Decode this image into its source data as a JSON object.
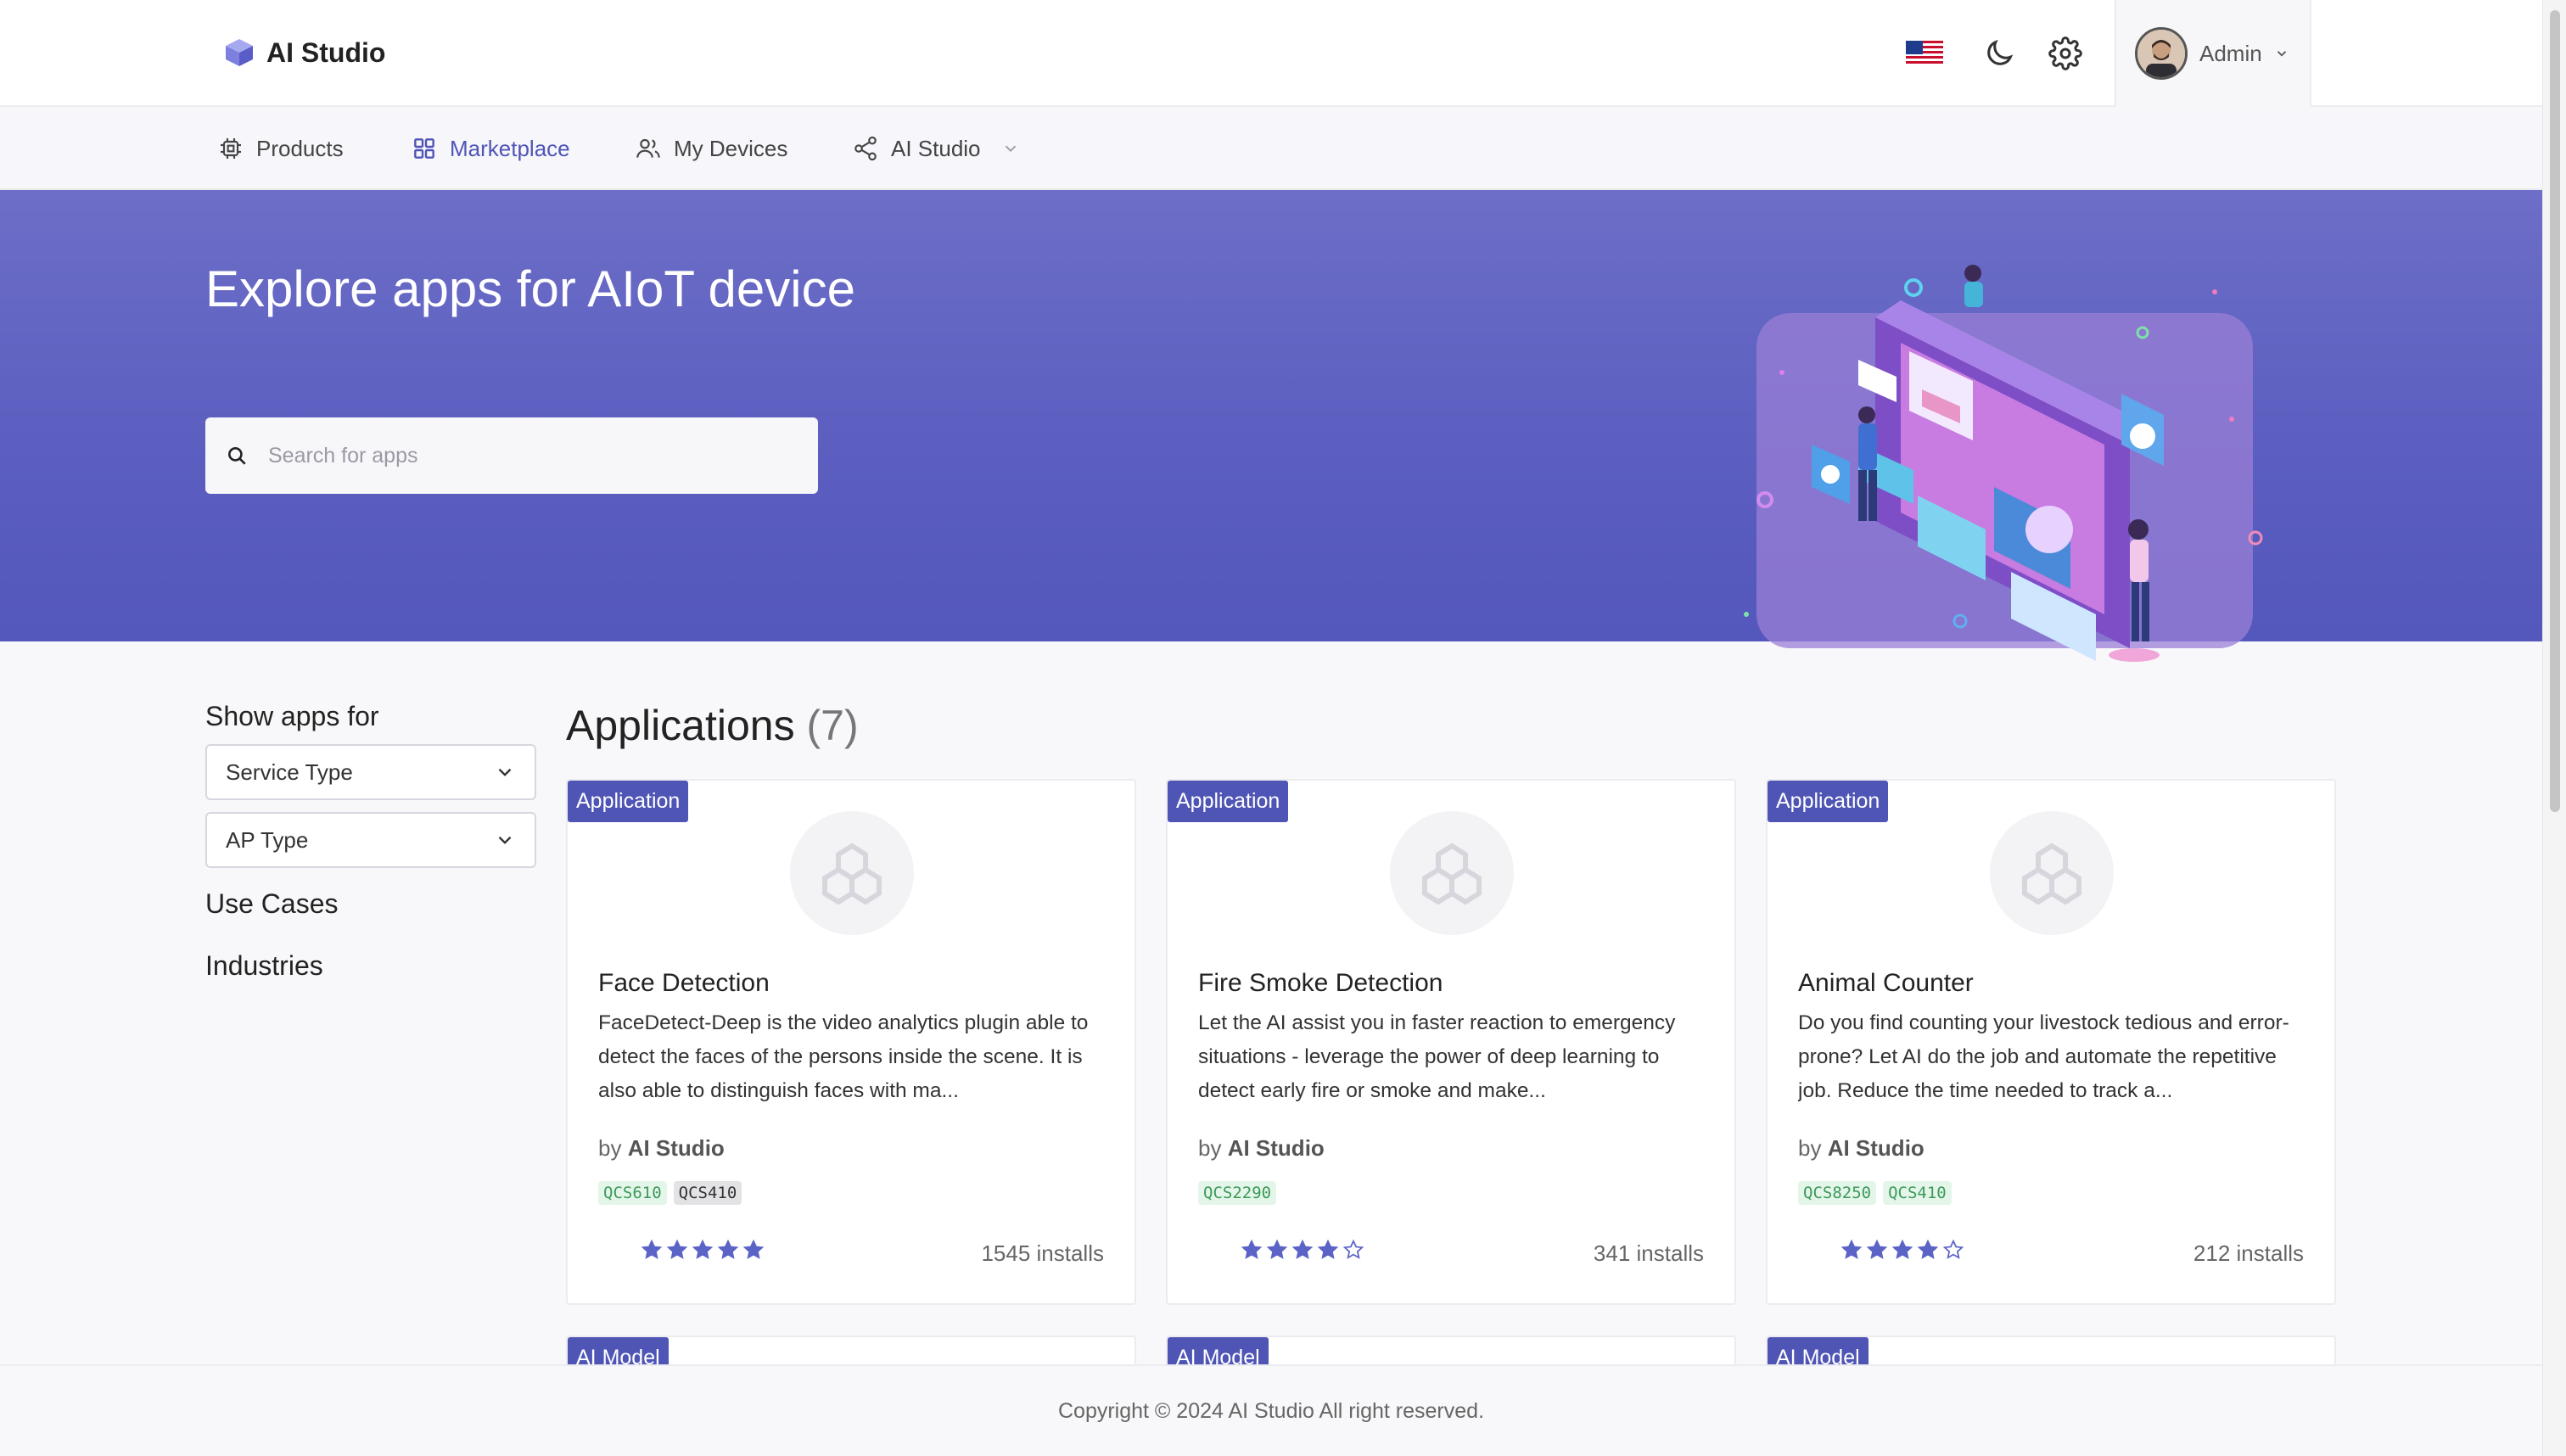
{
  "header": {
    "brand": "AI Studio",
    "user_name": "Admin",
    "icons": [
      "us-flag-icon",
      "moon-icon",
      "gear-icon",
      "avatar",
      "chevron-down-icon"
    ]
  },
  "nav": {
    "items": [
      {
        "label": "Products",
        "icon": "chip-icon"
      },
      {
        "label": "Marketplace",
        "icon": "grid-icon",
        "active": true
      },
      {
        "label": "My Devices",
        "icon": "users-icon"
      },
      {
        "label": "AI Studio",
        "icon": "share-icon"
      }
    ]
  },
  "hero": {
    "title": "Explore apps for AIoT device",
    "search_placeholder": "Search for apps"
  },
  "sidebar": {
    "title": "Show apps for",
    "service_type": "Service Type",
    "ap_type": "AP Type",
    "use_cases": "Use Cases",
    "industries": "Industries"
  },
  "applications": {
    "title": "Applications",
    "count": "(7)",
    "cards": [
      {
        "badge": "Application",
        "name": "Face Detection",
        "description": "FaceDetect-Deep is the video analytics plugin able to detect the faces of the persons inside the scene. It is also able to distinguish faces with ma...",
        "by_prefix": "by",
        "author": "AI Studio",
        "chips": [
          "QCS610",
          "QCS410"
        ],
        "rating": 5,
        "installs": "1545 installs"
      },
      {
        "badge": "Application",
        "name": "Fire Smoke Detection",
        "description": "Let the AI assist you in faster reaction to emergency situations - leverage the power of deep learning to detect early fire or smoke and make...",
        "by_prefix": "by",
        "author": "AI Studio",
        "chips": [
          "QCS2290"
        ],
        "rating": 4,
        "installs": "341 installs"
      },
      {
        "badge": "Application",
        "name": "Animal Counter",
        "description": "Do you find counting your livestock tedious and error-prone? Let AI do the job and automate the repetitive job. Reduce the time needed to track a...",
        "by_prefix": "by",
        "author": "AI Studio",
        "chips": [
          "QCS8250",
          "QCS410"
        ],
        "rating": 4,
        "installs": "212 installs"
      }
    ],
    "next_row_badges": [
      "AI Model",
      "AI Model",
      "AI Model"
    ]
  },
  "footer": {
    "copyright": "Copyright © 2024 AI Studio All right reserved."
  },
  "colors": {
    "accent": "#4f55b5",
    "hero_top": "#6c6ec7",
    "hero_bottom": "#5457bb",
    "chip_green_bg": "#e4f6e9",
    "chip_green_text": "#3c9a5a"
  }
}
